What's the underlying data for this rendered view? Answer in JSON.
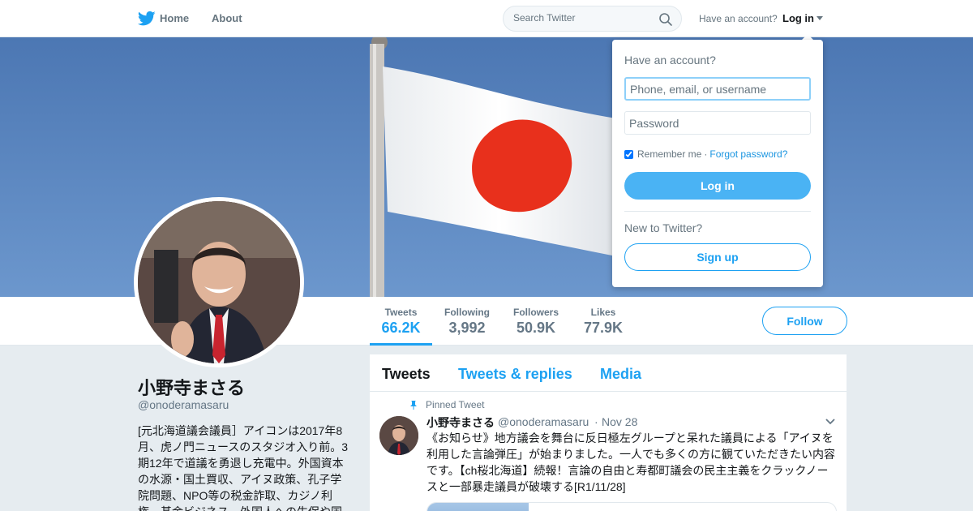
{
  "nav": {
    "logo_icon": "twitter-bird-icon",
    "home_label": "Home",
    "about_label": "About",
    "search_placeholder": "Search Twitter",
    "have_account_text": "Have an account?",
    "login_label": "Log in"
  },
  "profile": {
    "display_name": "小野寺まさる",
    "handle": "@onoderamasaru",
    "bio": "[元北海道議会議員］アイコンは2017年8月、虎ノ門ニュースのスタジオ入り前。3期12年で道議を勇退し充電中。外国資本の水源・国土買収、アイヌ政策、孔子学院問題、NPO等の税金詐取、カジノ利権、基金ビジネス、外国人への生保や国"
  },
  "stats": [
    {
      "label": "Tweets",
      "value": "66.2K"
    },
    {
      "label": "Following",
      "value": "3,992"
    },
    {
      "label": "Followers",
      "value": "50.9K"
    },
    {
      "label": "Likes",
      "value": "77.9K"
    }
  ],
  "follow_label": "Follow",
  "timeline": {
    "tabs": [
      "Tweets",
      "Tweets & replies",
      "Media"
    ],
    "pinned_label": "Pinned Tweet",
    "tweet": {
      "name": "小野寺まさる",
      "handle": "@onoderamasaru",
      "separator": "·",
      "date": "Nov 28",
      "text": "《お知らせ》地方議会を舞台に反日極左グループと呆れた議員による「アイヌを利用した言論弾圧」が始まりました。一人でも多くの方に観ていただきたい内容です。【ch桜北海道】続報！言論の自由と寿都町議会の民主主義をクラックノースと一部暴走議員が破壊する[R1/11/28]"
    }
  },
  "login_dropdown": {
    "heading": "Have an account?",
    "username_placeholder": "Phone, email, or username",
    "password_placeholder": "Password",
    "remember_label": "Remember me",
    "separator": "·",
    "forgot_label": "Forgot password?",
    "login_button": "Log in",
    "new_text": "New to Twitter?",
    "signup_button": "Sign up"
  },
  "colors": {
    "accent": "#1da1f2",
    "login_button": "#4ab3f4",
    "banner_sky": "#5b87c2",
    "flag_red": "#e8301c"
  }
}
